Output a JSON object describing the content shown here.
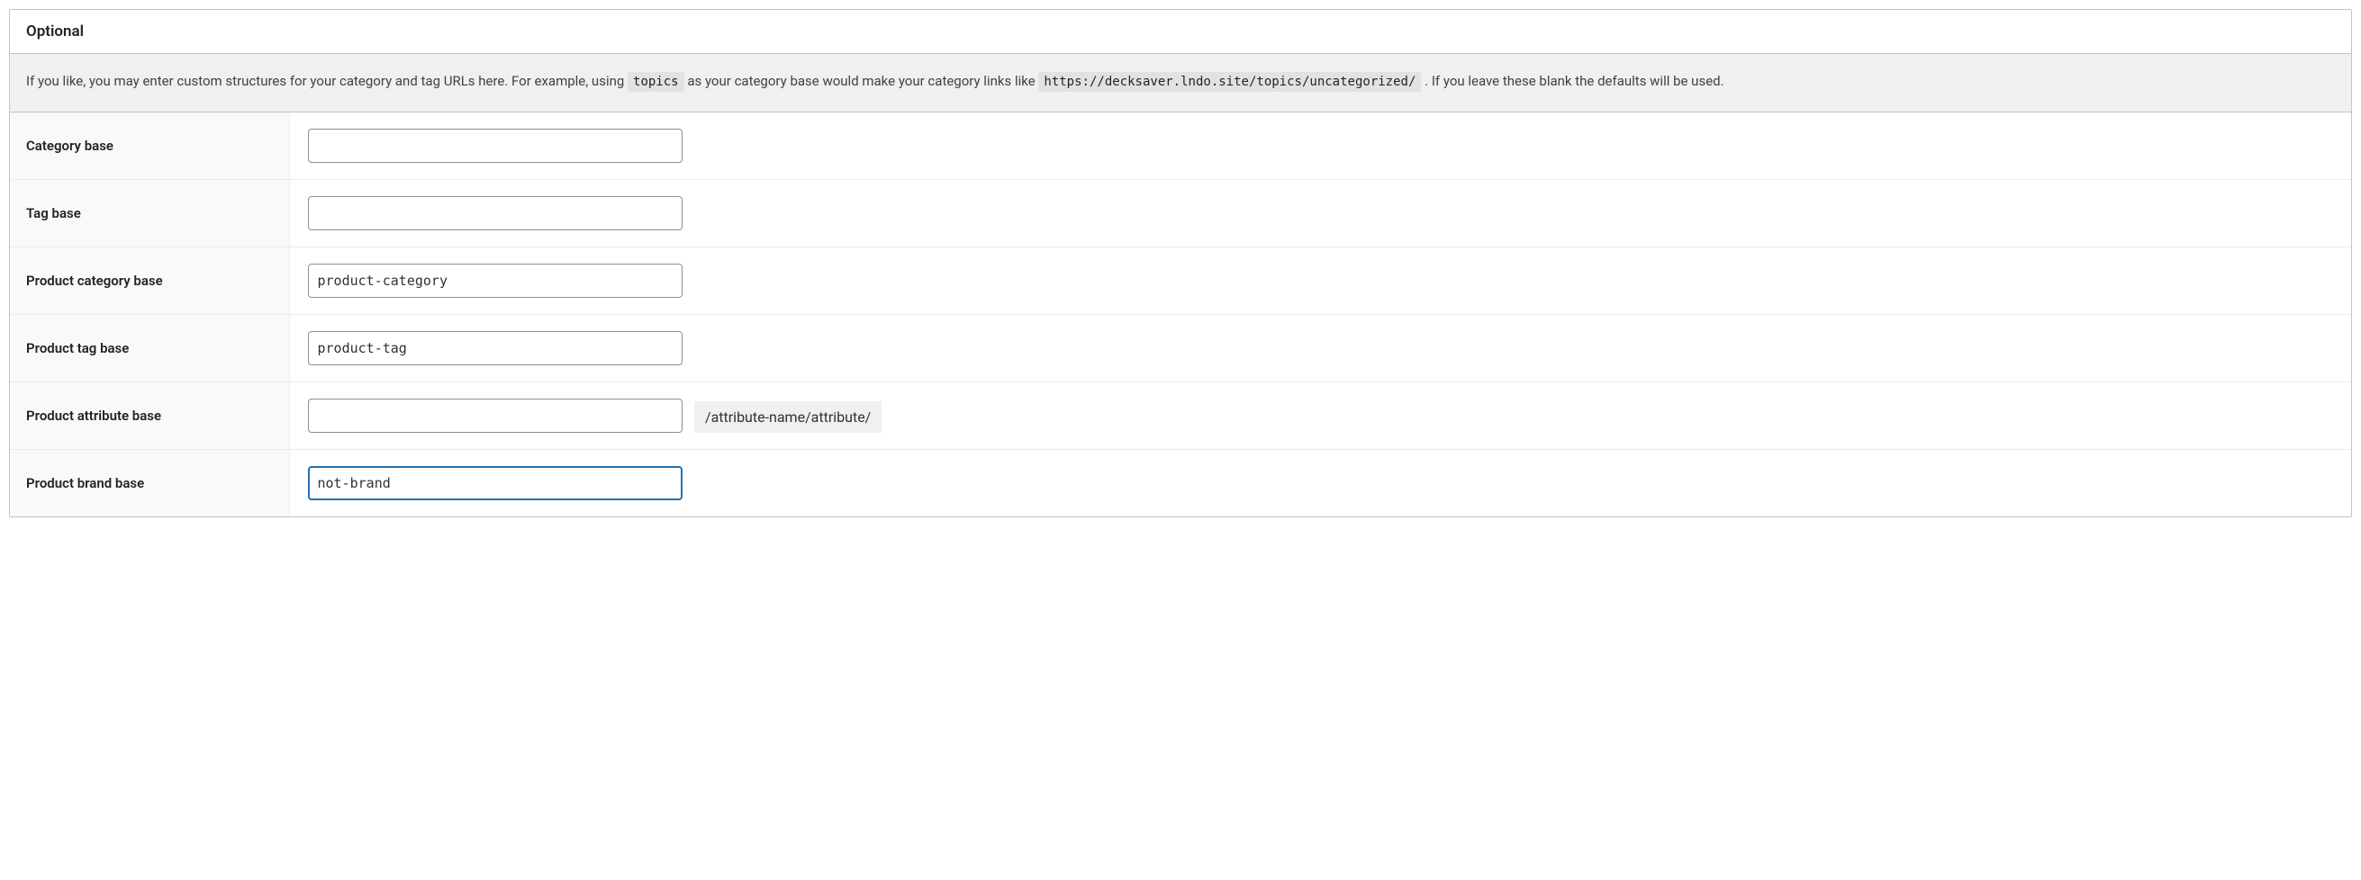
{
  "box": {
    "title": "Optional",
    "description": {
      "pre": "If you like, you may enter custom structures for your category and tag URLs here. For example, using ",
      "code1": "topics",
      "mid": " as your category base would make your category links like ",
      "code2": "https://decksaver.lndo.site/topics/uncategorized/",
      "post": " . If you leave these blank the defaults will be used."
    }
  },
  "fields": {
    "category_base": {
      "label": "Category base",
      "value": ""
    },
    "tag_base": {
      "label": "Tag base",
      "value": ""
    },
    "product_category_base": {
      "label": "Product category base",
      "value": "product-category"
    },
    "product_tag_base": {
      "label": "Product tag base",
      "value": "product-tag"
    },
    "product_attribute_base": {
      "label": "Product attribute base",
      "value": "",
      "suffix": "/attribute-name/attribute/"
    },
    "product_brand_base": {
      "label": "Product brand base",
      "value": "not-brand"
    }
  }
}
